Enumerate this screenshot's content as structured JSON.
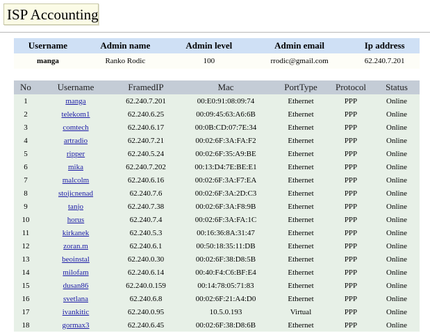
{
  "page": {
    "title": "ISP Accounting"
  },
  "admin": {
    "headers": [
      "Username",
      "Admin name",
      "Admin level",
      "Admin email",
      "Ip address"
    ],
    "row": {
      "username": "manga",
      "admin_name": "Ranko Rodic",
      "admin_level": "100",
      "admin_email": "rrodic@gmail.com",
      "ip_address": "62.240.7.201"
    }
  },
  "sessions": {
    "headers": [
      "No",
      "Username",
      "FramedIP",
      "Mac",
      "PortType",
      "Protocol",
      "Status"
    ],
    "rows": [
      {
        "no": "1",
        "username": "manga",
        "ip": "62.240.7.201",
        "mac": "00:E0:91:08:09:74",
        "port": "Ethernet",
        "protocol": "PPP",
        "status": "Online"
      },
      {
        "no": "2",
        "username": "telekom1",
        "ip": "62.240.6.25",
        "mac": "00:09:45:63:A6:6B",
        "port": "Ethernet",
        "protocol": "PPP",
        "status": "Online"
      },
      {
        "no": "3",
        "username": "comtech",
        "ip": "62.240.6.17",
        "mac": "00:0B:CD:07:7E:34",
        "port": "Ethernet",
        "protocol": "PPP",
        "status": "Online"
      },
      {
        "no": "4",
        "username": "artradio",
        "ip": "62.240.7.21",
        "mac": "00:02:6F:3A:FA:F2",
        "port": "Ethernet",
        "protocol": "PPP",
        "status": "Online"
      },
      {
        "no": "5",
        "username": "ripper",
        "ip": "62.240.5.24",
        "mac": "00:02:6F:35:A9:BE",
        "port": "Ethernet",
        "protocol": "PPP",
        "status": "Online"
      },
      {
        "no": "6",
        "username": "mika",
        "ip": "62.240.7.202",
        "mac": "00:13:D4:7E:BE:E1",
        "port": "Ethernet",
        "protocol": "PPP",
        "status": "Online"
      },
      {
        "no": "7",
        "username": "malcolm",
        "ip": "62.240.6.16",
        "mac": "00:02:6F:3A:F7:EA",
        "port": "Ethernet",
        "protocol": "PPP",
        "status": "Online"
      },
      {
        "no": "8",
        "username": "stojicnenad",
        "ip": "62.240.7.6",
        "mac": "00:02:6F:3A:2D:C3",
        "port": "Ethernet",
        "protocol": "PPP",
        "status": "Online"
      },
      {
        "no": "9",
        "username": "tanjo",
        "ip": "62.240.7.38",
        "mac": "00:02:6F:3A:F8:9B",
        "port": "Ethernet",
        "protocol": "PPP",
        "status": "Online"
      },
      {
        "no": "10",
        "username": "horus",
        "ip": "62.240.7.4",
        "mac": "00:02:6F:3A:FA:1C",
        "port": "Ethernet",
        "protocol": "PPP",
        "status": "Online"
      },
      {
        "no": "11",
        "username": "kirkanek",
        "ip": "62.240.5.3",
        "mac": "00:16:36:8A:31:47",
        "port": "Ethernet",
        "protocol": "PPP",
        "status": "Online"
      },
      {
        "no": "12",
        "username": "zoran.m",
        "ip": "62.240.6.1",
        "mac": "00:50:18:35:11:DB",
        "port": "Ethernet",
        "protocol": "PPP",
        "status": "Online"
      },
      {
        "no": "13",
        "username": "beoinstal",
        "ip": "62.240.0.30",
        "mac": "00:02:6F:38:D8:5B",
        "port": "Ethernet",
        "protocol": "PPP",
        "status": "Online"
      },
      {
        "no": "14",
        "username": "milofam",
        "ip": "62.240.6.14",
        "mac": "00:40:F4:C6:BF:E4",
        "port": "Ethernet",
        "protocol": "PPP",
        "status": "Online"
      },
      {
        "no": "15",
        "username": "dusan86",
        "ip": "62.240.0.159",
        "mac": "00:14:78:05:71:83",
        "port": "Ethernet",
        "protocol": "PPP",
        "status": "Online"
      },
      {
        "no": "16",
        "username": "svetlana",
        "ip": "62.240.6.8",
        "mac": "00:02:6F:21:A4:D0",
        "port": "Ethernet",
        "protocol": "PPP",
        "status": "Online"
      },
      {
        "no": "17",
        "username": "ivankitic",
        "ip": "62.240.0.95",
        "mac": "10.5.0.193",
        "port": "Virtual",
        "protocol": "PPP",
        "status": "Online"
      },
      {
        "no": "18",
        "username": "gormax3",
        "ip": "62.240.6.45",
        "mac": "00:02:6F:38:D8:6B",
        "port": "Ethernet",
        "protocol": "PPP",
        "status": "Online"
      }
    ]
  }
}
